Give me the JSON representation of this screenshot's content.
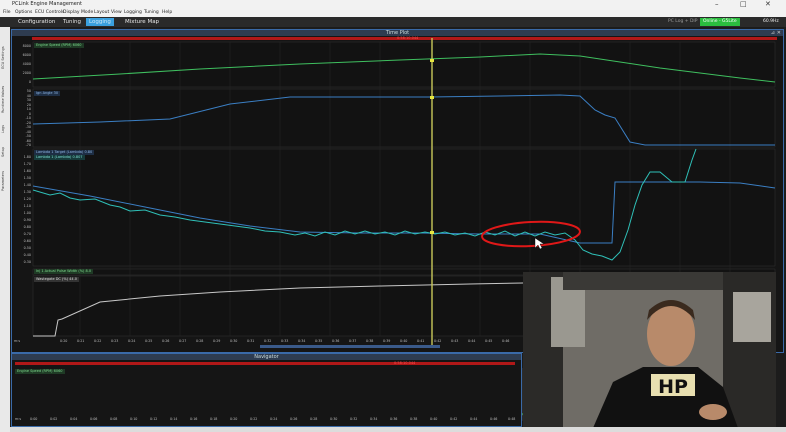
{
  "window": {
    "title": "PCLink Engine Management"
  },
  "menu": [
    "File",
    "Options",
    "ECU Controls",
    "Display Mode",
    "Layout",
    "View",
    "Logging",
    "Tuning",
    "Help"
  ],
  "tabs": [
    {
      "label": "Configuration",
      "active": false
    },
    {
      "label": "Tuning",
      "active": false
    },
    {
      "label": "Logging",
      "active": true
    },
    {
      "label": "Mixture Map",
      "active": false
    }
  ],
  "status": {
    "connection": "PC Log + DIP",
    "online": "Online - G5Lite",
    "rate": "60.9Hz"
  },
  "sidebar": [
    "ECU Settings",
    "Runtime Values",
    "Logs",
    "Setup",
    "Parameters"
  ],
  "timeplot": {
    "title": "Time Plot",
    "cursor_time": "0:58:10.044",
    "p1": {
      "label": "Engine Speed (RPM)",
      "value": "6060",
      "ticks": [
        "8000",
        "6000",
        "4000",
        "2000",
        "0"
      ]
    },
    "p2": {
      "label": "Ign Angle",
      "value": "30",
      "ticks": [
        "50",
        "40",
        "30",
        "20",
        "10",
        "0",
        "-10",
        "-20",
        "-30",
        "-40",
        "-50",
        "-60",
        "-70"
      ]
    },
    "p3": {
      "label1": "Lambda 1 Target (Lambda)",
      "value1": "0.80",
      "label2": "Lambda 1 (Lambda)",
      "value2": "0.807",
      "ticks": [
        "1.80",
        "1.70",
        "1.60",
        "1.50",
        "1.40",
        "1.30",
        "1.20",
        "1.10",
        "1.00",
        "0.90",
        "0.80",
        "0.70",
        "0.60",
        "0.50",
        "0.40",
        "0.30"
      ]
    },
    "p4": {
      "label": "Inj 1 Actual Pulse Width (%)",
      "value": "8.0"
    },
    "p5": {
      "label": "Wastegate DC (%)",
      "value": "44.0"
    },
    "xticks": [
      "0:20",
      "0:21",
      "0:22",
      "0:23",
      "0:24",
      "0:25",
      "0:26",
      "0:27",
      "0:28",
      "0:29",
      "0:30",
      "0:31",
      "0:32",
      "0:33",
      "0:34",
      "0:35",
      "0:36",
      "0:37",
      "0:38",
      "0:39",
      "0:40",
      "0:41",
      "0:42",
      "0:43",
      "0:44",
      "0:45",
      "0:46",
      "0:47",
      "0:48",
      "0:49",
      "0:50"
    ]
  },
  "navigator": {
    "title": "Navigator",
    "cursor_time": "0:58:10.044",
    "label": "Engine Speed (RPM)",
    "value": "6060",
    "xticks": [
      "0:00",
      "0:02",
      "0:04",
      "0:06",
      "0:08",
      "0:10",
      "0:12",
      "0:14",
      "0:16",
      "0:18",
      "0:20",
      "0:22",
      "0:24",
      "0:26",
      "0:28",
      "0:30",
      "0:32",
      "0:34",
      "0:36",
      "0:38",
      "0:40",
      "0:42",
      "0:44",
      "0:46",
      "0:48"
    ],
    "unit": "m:s"
  },
  "video": {
    "shirt_text": "HP"
  },
  "colors": {
    "accent": "#3aa0de",
    "plot_line_blue": "#3b7fc4",
    "plot_line_green": "#3fbf5f",
    "cursor": "#c8c85a",
    "annotation": "#e01818",
    "online": "#2bbd3f"
  }
}
